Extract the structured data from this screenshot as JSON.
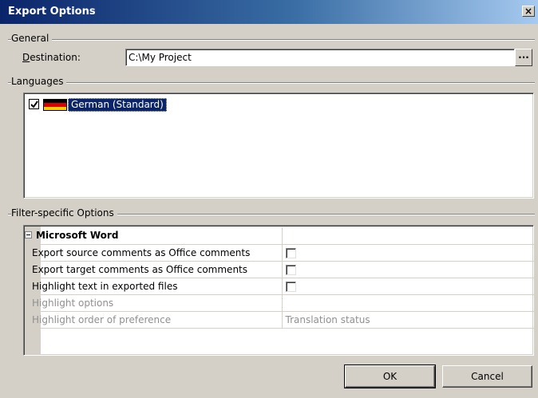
{
  "window": {
    "title": "Export Options",
    "close_glyph": "×"
  },
  "general": {
    "label": "General",
    "destination_label_mnemonic": "D",
    "destination_label_rest": "estination:",
    "destination_value": "C:\\My Project",
    "browse_label": "..."
  },
  "languages": {
    "label": "Languages",
    "items": [
      {
        "name": "German (Standard)",
        "checked": true,
        "selected": true
      }
    ]
  },
  "filter_options": {
    "label": "Filter-specific Options",
    "category": "Microsoft Word",
    "rows": [
      {
        "label": "Export source comments as Office comments",
        "type": "checkbox",
        "checked": false,
        "enabled": true
      },
      {
        "label": "Export target comments as Office comments",
        "type": "checkbox",
        "checked": false,
        "enabled": true
      },
      {
        "label": "Highlight text in exported files",
        "type": "checkbox",
        "checked": false,
        "enabled": true
      },
      {
        "label": "Highlight options",
        "value": "",
        "enabled": false
      },
      {
        "label": "Highlight order of preference",
        "value": "Translation status",
        "enabled": false
      }
    ]
  },
  "buttons": {
    "ok": "OK",
    "cancel": "Cancel"
  },
  "colors": {
    "titlebar_start": "#0a246a",
    "titlebar_end": "#a6caf0",
    "selection": "#0a246a",
    "face": "#d4d0c8"
  },
  "icons": {
    "flag": "german-flag-icon",
    "check": "checkmark-icon",
    "collapse": "minus-expander-icon",
    "close": "close-icon"
  }
}
